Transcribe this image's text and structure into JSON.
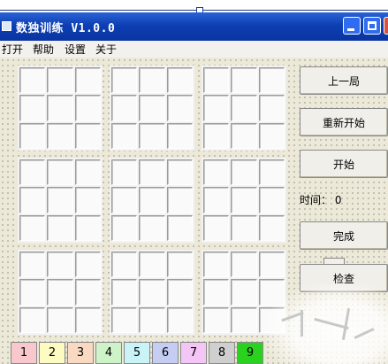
{
  "window": {
    "title": "数独训练 V1.0.0"
  },
  "menu": [
    "打开",
    "帮助",
    "设置",
    "关于"
  ],
  "buttons": {
    "prev": "上一局",
    "restart": "重新开始",
    "start": "开始",
    "finish": "完成",
    "check": "检查"
  },
  "timer": {
    "label": "时间：",
    "value": "0"
  },
  "palette": [
    {
      "label": "1",
      "color": "#f8c8cc"
    },
    {
      "label": "2",
      "color": "#fdfac2"
    },
    {
      "label": "3",
      "color": "#f9d9c2"
    },
    {
      "label": "4",
      "color": "#cff3c9"
    },
    {
      "label": "5",
      "color": "#c9f3f6"
    },
    {
      "label": "6",
      "color": "#c6cdf2"
    },
    {
      "label": "7",
      "color": "#f4c6f6"
    },
    {
      "label": "8",
      "color": "#cfcfcf"
    },
    {
      "label": "9",
      "color": "#2ad21f"
    }
  ],
  "colors": {
    "titlebar": "#0d3fb3",
    "client_bg": "#ece9d8"
  }
}
